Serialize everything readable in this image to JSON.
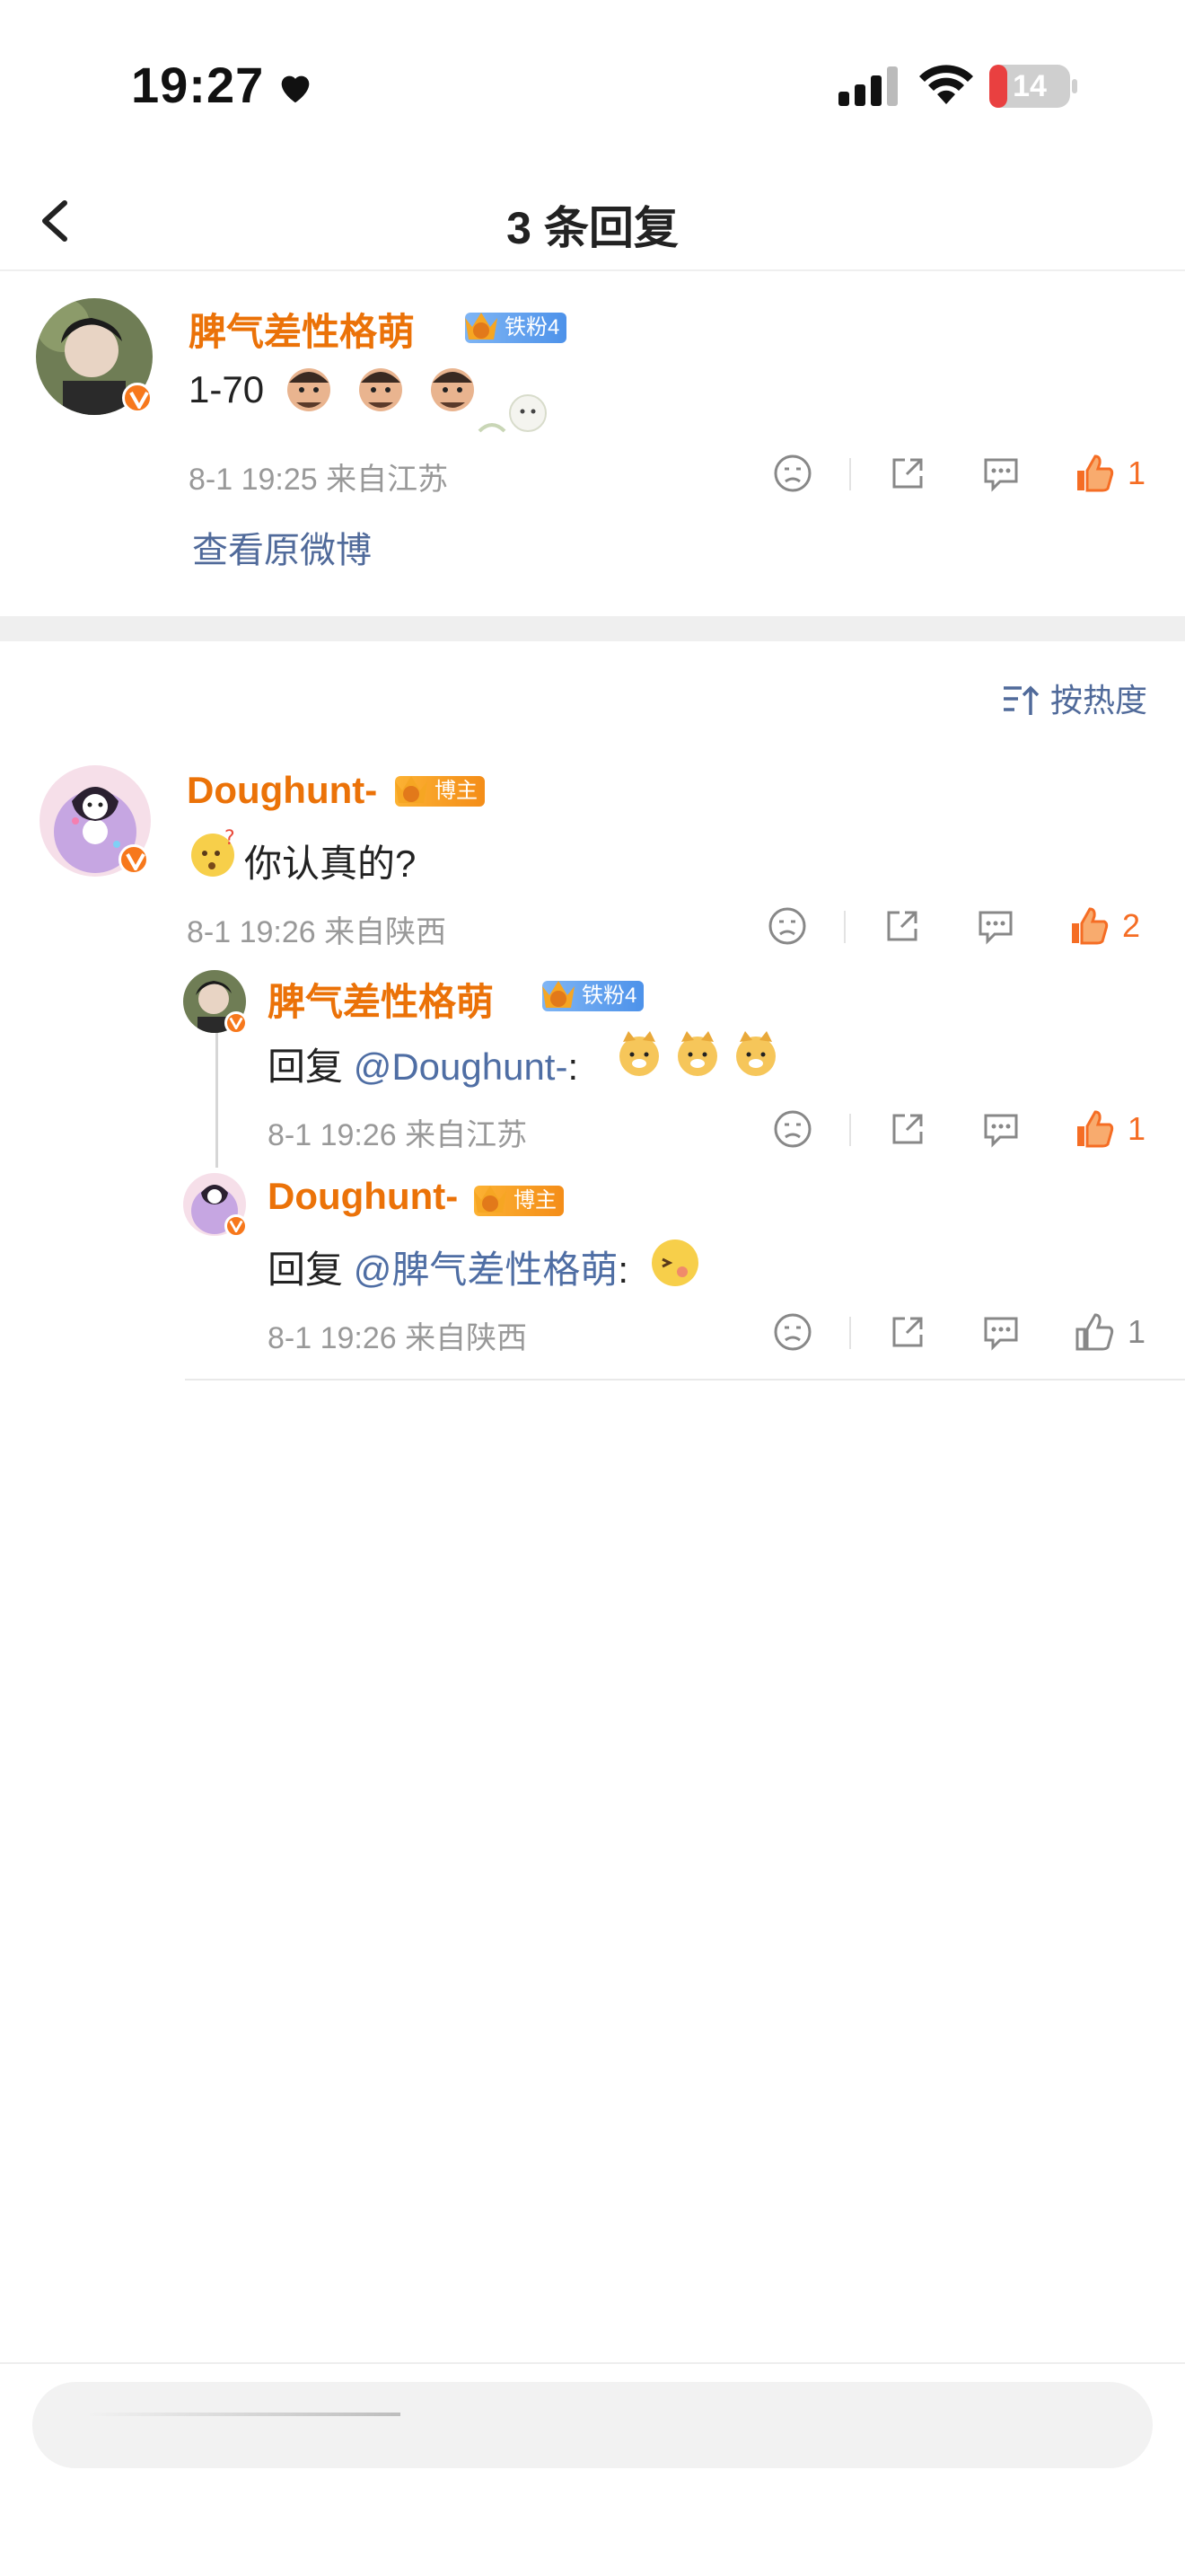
{
  "status_bar": {
    "time": "19:27",
    "battery": "14"
  },
  "header": {
    "title": "3 条回复"
  },
  "main_comment": {
    "username": "脾气差性格萌",
    "badge": "铁粉4",
    "badge_level": "3",
    "text": "1-70",
    "meta": "8-1 19:25  来自江苏",
    "likes": "1",
    "view_original": "查看原微博"
  },
  "sort": {
    "label": "按热度"
  },
  "replies": [
    {
      "username": "Doughunt-",
      "badge": "博主",
      "badge_level": "5",
      "text": "你认真的?",
      "meta": "8-1 19:26  来自陕西",
      "likes": "2"
    },
    {
      "username": "脾气差性格萌",
      "badge": "铁粉4",
      "badge_level": "3",
      "text_prefix": "回复",
      "mention": "@Doughunt-",
      "text_suffix": ":",
      "meta": "8-1 19:26  来自江苏",
      "likes": "1"
    },
    {
      "username": "Doughunt-",
      "badge": "博主",
      "badge_level": "5",
      "text_prefix": "回复",
      "mention": "@脾气差性格萌",
      "text_suffix": ":",
      "meta": "8-1 19:26  来自陕西",
      "likes": "1"
    }
  ],
  "colors": {
    "accent": "#eb7208",
    "link": "#506a9a",
    "like_active": "#f56d24",
    "meta": "#999999"
  },
  "icons": [
    "back-icon",
    "dislike-icon",
    "share-icon",
    "comment-icon",
    "like-icon",
    "sort-icon",
    "verified-icon",
    "crown-icon"
  ]
}
